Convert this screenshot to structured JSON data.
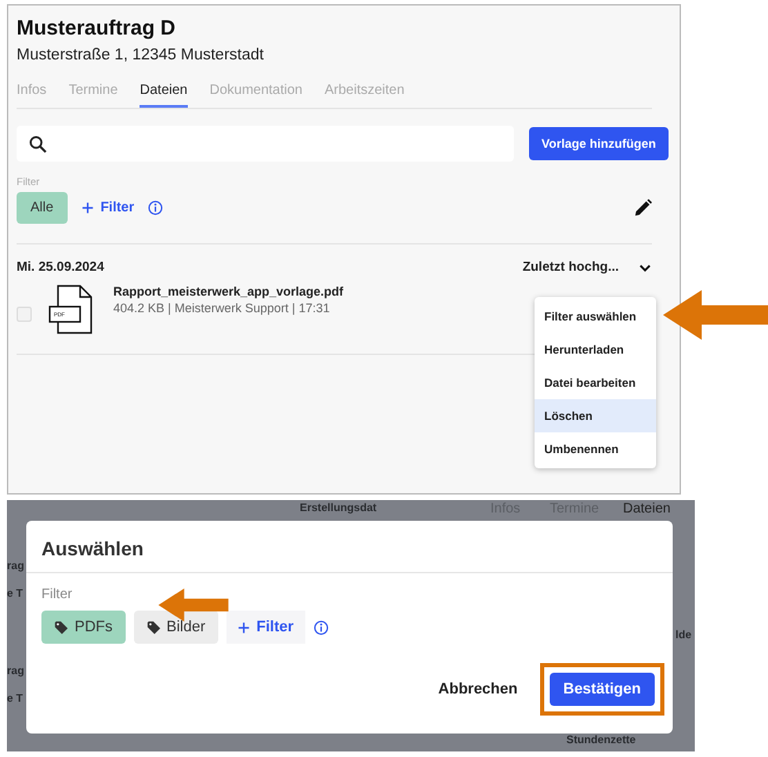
{
  "order_view": {
    "title": "Musterauftrag D",
    "address": "Musterstraße 1, 12345 Musterstadt",
    "tabs": [
      {
        "label": "Infos",
        "selected": false
      },
      {
        "label": "Termine",
        "selected": false
      },
      {
        "label": "Dateien",
        "selected": true
      },
      {
        "label": "Dokumentation",
        "selected": false
      },
      {
        "label": "Arbeitszeiten",
        "selected": false
      }
    ],
    "add_template_button": "Vorlage hinzufügen",
    "filter": {
      "label": "Filter",
      "chips": [
        {
          "label": "Alle",
          "selected": true
        }
      ],
      "add_filter": "Filter"
    },
    "file_groups": [
      {
        "date": "Mi. 25.09.2024",
        "sort": "Zuletzt hochg...",
        "files": [
          {
            "name": "Rapport_meisterwerk_app_vorlage.pdf",
            "icon_label": "PDF",
            "meta": "404.2 KB | Meisterwerk Support | 17:31",
            "checked": false
          }
        ]
      }
    ],
    "context_menu": {
      "items": [
        {
          "label": "Filter auswählen",
          "selected": false
        },
        {
          "label": "Herunterladen",
          "selected": false
        },
        {
          "label": "Datei bearbeiten",
          "selected": false
        },
        {
          "label": "Löschen",
          "selected": true
        },
        {
          "label": "Umbenennen",
          "selected": false
        }
      ]
    }
  },
  "filter_dialog": {
    "backdrop_texts": [
      "Erstellungsdat",
      "Infos",
      "Termine",
      "Dateien",
      "rag",
      "e T",
      "rag",
      "e T",
      "lde",
      "Stundenzette"
    ],
    "title": "Auswählen",
    "filter_label": "Filter",
    "chips": [
      {
        "label": "PDFs",
        "selected": true
      },
      {
        "label": "Bilder",
        "selected": false
      }
    ],
    "add_filter": "Filter",
    "cancel": "Abbrechen",
    "confirm": "Bestätigen"
  }
}
